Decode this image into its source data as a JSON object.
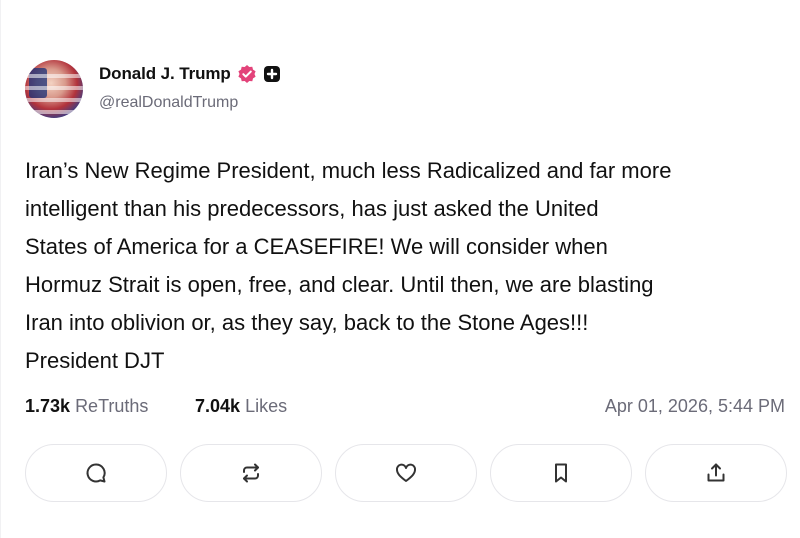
{
  "author": {
    "display_name": "Donald J. Trump",
    "handle": "@realDonaldTrump",
    "avatar_icon": "avatar-image",
    "verified_badge_color": "#e3437a",
    "plus_badge_color": "#111111"
  },
  "post": {
    "text": "Iran’s New Regime President, much less Radicalized and far more\nintelligent than his predecessors, has just asked the United\nStates of America for a CEASEFIRE! We will consider when\nHormuz Strait is open, free, and clear. Until then, we are blasting\nIran into oblivion or, as they say, back to the Stone Ages!!!\nPresident DJT"
  },
  "stats": {
    "retruths_count": "1.73k",
    "retruths_label": "ReTruths",
    "likes_count": "7.04k",
    "likes_label": "Likes",
    "timestamp": "Apr 01, 2026, 5:44 PM"
  },
  "actions": [
    {
      "name": "reply",
      "icon": "comment-icon"
    },
    {
      "name": "retruth",
      "icon": "repost-icon"
    },
    {
      "name": "like",
      "icon": "heart-icon"
    },
    {
      "name": "bookmark",
      "icon": "bookmark-icon"
    },
    {
      "name": "share",
      "icon": "share-icon"
    }
  ]
}
